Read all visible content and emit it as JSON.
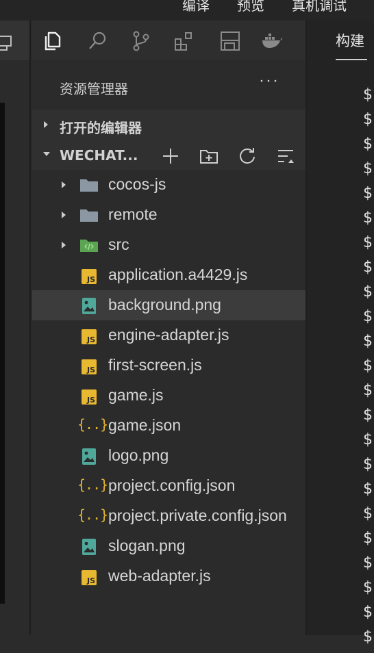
{
  "top_menu": [
    "编译",
    "预览",
    "真机调试"
  ],
  "activity_icons": [
    "files-icon",
    "search-icon",
    "source-control-icon",
    "extensions-icon",
    "save-layout-icon",
    "docker-icon"
  ],
  "explorer": {
    "title": "资源管理器",
    "more": "···",
    "open_editors_label": "打开的编辑器",
    "project_label": "WECHAT..."
  },
  "files": [
    {
      "name": "cocos-js",
      "type": "folder",
      "expandable": true
    },
    {
      "name": "remote",
      "type": "folder",
      "expandable": true
    },
    {
      "name": "src",
      "type": "folder-src",
      "expandable": true
    },
    {
      "name": "application.a4429.js",
      "type": "js"
    },
    {
      "name": "background.png",
      "type": "image",
      "selected": true
    },
    {
      "name": "engine-adapter.js",
      "type": "js"
    },
    {
      "name": "first-screen.js",
      "type": "js"
    },
    {
      "name": "game.js",
      "type": "js"
    },
    {
      "name": "game.json",
      "type": "json"
    },
    {
      "name": "logo.png",
      "type": "image"
    },
    {
      "name": "project.config.json",
      "type": "json"
    },
    {
      "name": "project.private.config.json",
      "type": "json"
    },
    {
      "name": "slogan.png",
      "type": "image"
    },
    {
      "name": "web-adapter.js",
      "type": "js"
    }
  ],
  "right_panel": {
    "tab_label": "构建",
    "prompt_symbol": "$",
    "prompt_count": 23
  },
  "colors": {
    "js": "#e8b830",
    "json": "#e5b62f",
    "image": "#4fa89a",
    "folder": "#8b97a3",
    "src_folder": "#5aa454",
    "selected_row": "#3c3c3c"
  }
}
